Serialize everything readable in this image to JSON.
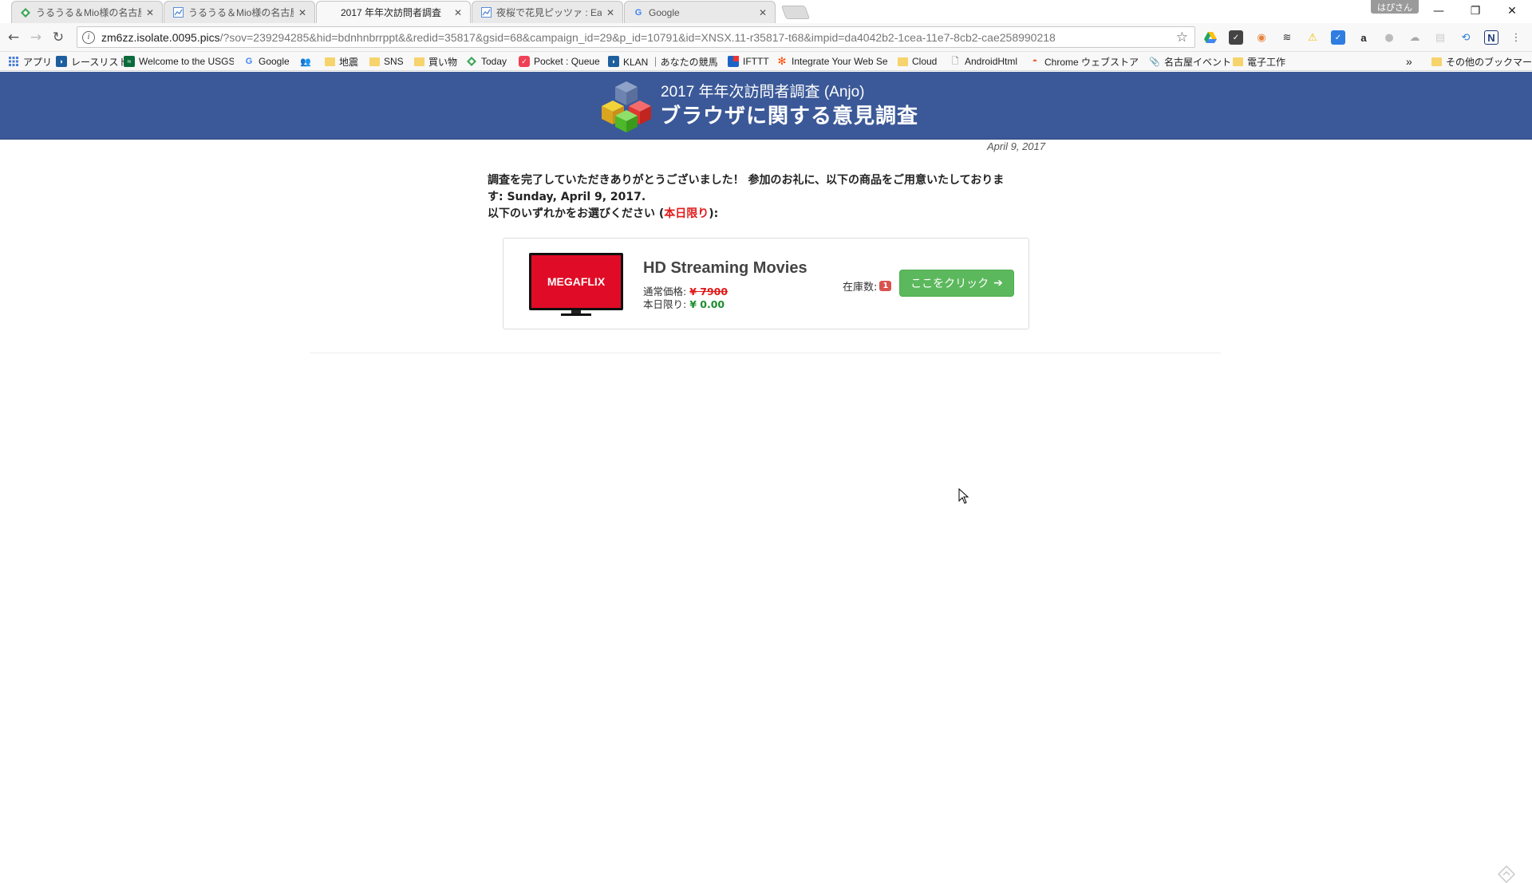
{
  "tabs": [
    {
      "title": "うるうる＆Mio様の名古屋ミ",
      "icon": "green-diamond-icon"
    },
    {
      "title": "うるうる＆Mio様の名古屋ミ",
      "icon": "chart-icon"
    },
    {
      "title": "2017 年年次訪問者調査",
      "icon": "blank-page-icon"
    },
    {
      "title": "夜桜で花見ピッツァ : Eat an",
      "icon": "chart-icon"
    },
    {
      "title": "Google",
      "icon": "google-icon"
    }
  ],
  "profile_name": "はぴさん",
  "url": {
    "host": "zm6zz.isolate.0095.pics",
    "path": "/?sov=239294285&hid=bdnhnbrrppt&&redid=35817&gsid=68&campaign_id=29&p_id=10791&id=XNSX.11-r35817-t68&impid=da4042b2-1cea-11e7-8cb2-cae258990218"
  },
  "bookmarks": [
    {
      "label": "アプリ",
      "icon": "apps-grid-icon"
    },
    {
      "label": "レースリスト",
      "icon": "shield-icon"
    },
    {
      "label": "Welcome to the USGS",
      "icon": "usgs-icon"
    },
    {
      "label": "Google",
      "icon": "google-icon"
    },
    {
      "label": "",
      "icon": "people-icon"
    },
    {
      "label": "地震",
      "icon": "folder-icon"
    },
    {
      "label": "SNS",
      "icon": "folder-icon"
    },
    {
      "label": "買い物",
      "icon": "folder-icon"
    },
    {
      "label": "Today",
      "icon": "green-diamond-icon"
    },
    {
      "label": "Pocket : Queue",
      "icon": "pocket-icon"
    },
    {
      "label": "KLAN ｜あなたの競馬予",
      "icon": "shield-icon"
    },
    {
      "label": "IFTTT",
      "icon": "ifttt-icon"
    },
    {
      "label": "Integrate Your Web Se",
      "icon": "zapier-icon"
    },
    {
      "label": "Cloud",
      "icon": "folder-icon"
    },
    {
      "label": "AndroidHtml",
      "icon": "page-icon"
    },
    {
      "label": "Chrome ウェブストア - V",
      "icon": "webstore-icon"
    },
    {
      "label": "名古屋イベント",
      "icon": "clip-icon"
    },
    {
      "label": "電子工作",
      "icon": "folder-icon"
    }
  ],
  "bookmarks_overflow": "»",
  "other_bookmarks": "その他のブックマーク",
  "survey": {
    "subtitle": "2017 年年次訪問者調査 (Anjo)",
    "title": "ブラウザに関する意見調査",
    "date": "April 9, 2017",
    "intro_line1": "調査を完了していただきありがとうございました！ 参加のお礼に、以下の商品をご用意いたしておりま",
    "intro_line2": "す: Sunday, April 9, 2017.",
    "intro_line3_prefix": "以下のいずれかをお選びください (",
    "intro_line3_red": "本日限り",
    "intro_line3_suffix": "):"
  },
  "product": {
    "brand": "MEGAFLIX",
    "name": "HD Streaming Movies",
    "regular_label": "通常価格:",
    "regular_price": "¥ 7900",
    "today_label": "本日限り:",
    "today_price": "¥ 0.00",
    "stock_label": "在庫数:",
    "stock_count": "1",
    "button_label": "ここをクリック",
    "button_arrow": "➔"
  },
  "colors": {
    "banner": "#3b5998",
    "cta": "#5cb85c",
    "sale_red": "#e11919",
    "price_green": "#1e8e2e"
  }
}
